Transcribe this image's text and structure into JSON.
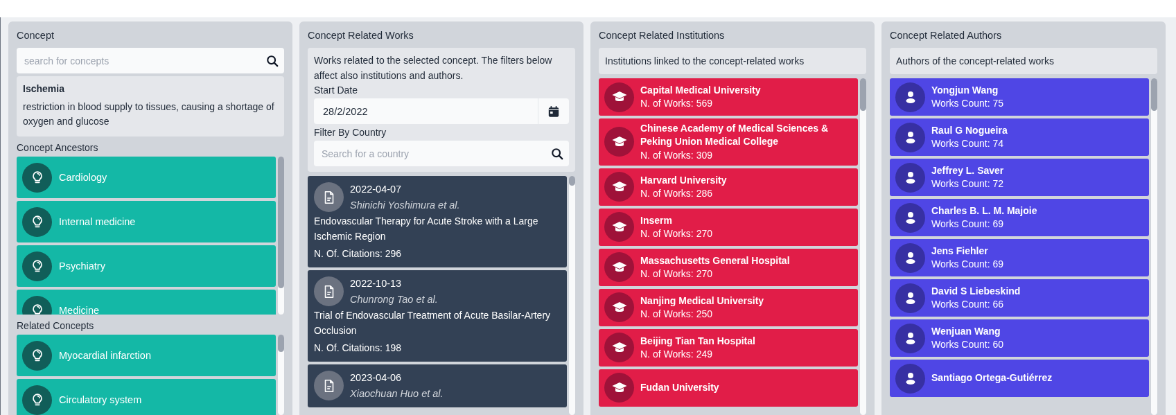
{
  "concept": {
    "title": "Concept",
    "search": {
      "placeholder": "search for concepts"
    },
    "selected_concept": {
      "name": "Ischemia",
      "description": "restriction in blood supply to tissues, causing a shortage of oxygen and glucose"
    },
    "ancestors_label": "Concept Ancestors",
    "ancestors": [
      {
        "label": "Cardiology"
      },
      {
        "label": "Internal medicine"
      },
      {
        "label": "Psychiatry"
      },
      {
        "label": "Medicine"
      }
    ],
    "related_label": "Related Concepts",
    "related": [
      {
        "label": "Myocardial infarction"
      },
      {
        "label": "Circulatory system"
      }
    ]
  },
  "works": {
    "title": "Concept Related Works",
    "description": "Works related to the selected concept. The filters below affect also institutions and authors.",
    "start_date_label": "Start Date",
    "start_date": "28/2/2022",
    "country_label": "Filter By Country",
    "country_search": {
      "placeholder": "Search for a country"
    },
    "items": [
      {
        "date": "2022-04-07",
        "authors": "Shinichi Yoshimura et al.",
        "title": "Endovascular Therapy for Acute Stroke with a Large Ischemic Region",
        "citations": "N. Of. Citations: 296"
      },
      {
        "date": "2022-10-13",
        "authors": "Chunrong Tao et al.",
        "title": "Trial of Endovascular Treatment of Acute Basilar-Artery Occlusion",
        "citations": "N. Of. Citations: 198"
      },
      {
        "date": "2023-04-06",
        "authors": "Xiaochuan Huo et al."
      }
    ]
  },
  "institutions": {
    "title": "Concept Related Institutions",
    "description": "Institutions linked to the concept-related works",
    "items": [
      {
        "name": "Capital Medical University",
        "count": "N. of Works: 569"
      },
      {
        "name": "Chinese Academy of Medical Sciences & Peking Union Medical College",
        "count": "N. of Works: 309"
      },
      {
        "name": "Harvard University",
        "count": "N. of Works: 286"
      },
      {
        "name": "Inserm",
        "count": "N. of Works: 270"
      },
      {
        "name": "Massachusetts General Hospital",
        "count": "N. of Works: 270"
      },
      {
        "name": "Nanjing Medical University",
        "count": "N. of Works: 250"
      },
      {
        "name": "Beijing Tian Tan Hospital",
        "count": "N. of Works: 249"
      },
      {
        "name": "Fudan University"
      }
    ]
  },
  "authors": {
    "title": "Concept Related Authors",
    "description": "Authors of the concept-related works",
    "items": [
      {
        "name": "Yongjun Wang",
        "count": "Works Count: 75"
      },
      {
        "name": "Raul G Nogueira",
        "count": "Works Count: 74"
      },
      {
        "name": "Jeffrey L. Saver",
        "count": "Works Count: 72"
      },
      {
        "name": "Charles B. L. M. Majoie",
        "count": "Works Count: 69"
      },
      {
        "name": "Jens Fiehler",
        "count": "Works Count: 69"
      },
      {
        "name": "David S Liebeskind",
        "count": "Works Count: 66"
      },
      {
        "name": "Wenjuan Wang",
        "count": "Works Count: 60"
      },
      {
        "name": "Santiago Ortega-Gutiérrez"
      }
    ]
  }
}
